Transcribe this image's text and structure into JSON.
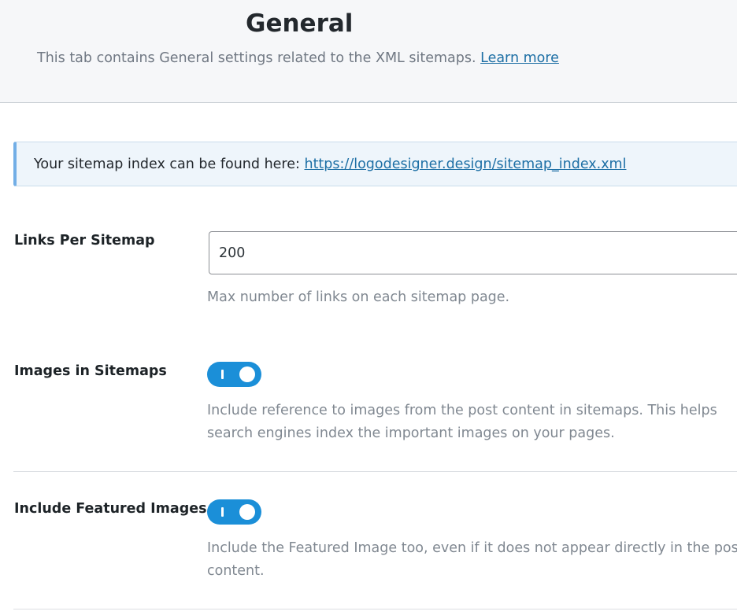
{
  "header": {
    "title": "General",
    "description": "This tab contains General settings related to the XML sitemaps.",
    "learn_more": "Learn more"
  },
  "notice": {
    "text": "Your sitemap index can be found here:",
    "link": "https://logodesigner.design/sitemap_index.xml"
  },
  "fields": {
    "links_per_sitemap": {
      "label": "Links Per Sitemap",
      "value": "200",
      "help": "Max number of links on each sitemap page."
    },
    "images_in_sitemaps": {
      "label": "Images in Sitemaps",
      "enabled": true,
      "help": "Include reference to images from the post content in sitemaps. This helps search engines index the important images on your pages."
    },
    "include_featured_images": {
      "label": "Include Featured Images",
      "enabled": true,
      "help": "Include the Featured Image too, even if it does not appear directly in the post content."
    }
  },
  "colors": {
    "toggle_on": "#1b8fd8",
    "link": "#1d6fa5",
    "notice_border": "#72aee6"
  }
}
